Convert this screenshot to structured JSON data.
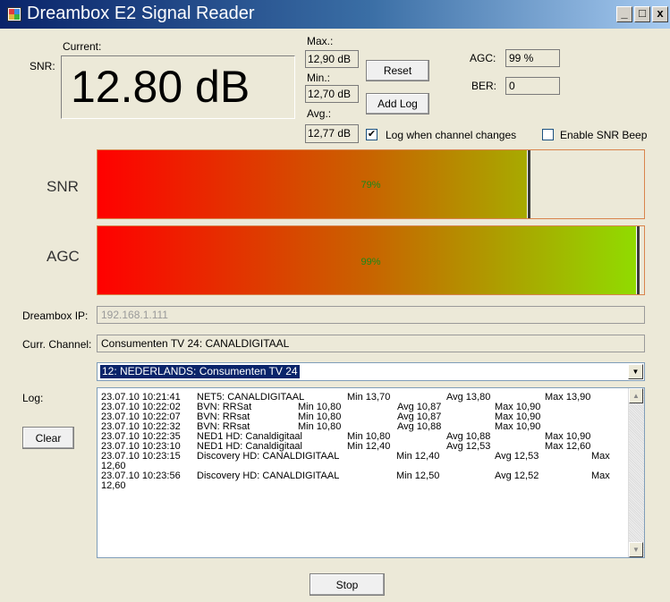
{
  "window": {
    "title": "Dreambox E2 Signal Reader",
    "minimize": "_",
    "maximize": "□",
    "close": "x"
  },
  "snr_panel": {
    "snr_label": "SNR:",
    "current_label": "Current:",
    "current_value": "12.80 dB"
  },
  "stats": {
    "max_label": "Max.:",
    "max_value": "12,90 dB",
    "min_label": "Min.:",
    "min_value": "12,70 dB",
    "avg_label": "Avg.:",
    "avg_value": "12,77 dB"
  },
  "buttons": {
    "reset": "Reset",
    "add_log": "Add Log",
    "clear": "Clear",
    "stop": "Stop"
  },
  "agc": {
    "label": "AGC:",
    "value": "99 %"
  },
  "ber": {
    "label": "BER:",
    "value": "0"
  },
  "options": {
    "log_channel_change": {
      "label": "Log when channel changes",
      "checked": true
    },
    "enable_snr_beep": {
      "label": "Enable SNR Beep",
      "checked": false
    }
  },
  "bars": {
    "snr": {
      "label": "SNR",
      "percent_text": "79%",
      "level": 0.79
    },
    "agc": {
      "label": "AGC",
      "percent_text": "99%",
      "level": 0.99
    }
  },
  "dreambox_ip": {
    "label": "Dreambox IP:",
    "value": "192.168.1.111"
  },
  "current_channel": {
    "label": "Curr. Channel:",
    "value": "Consumenten TV 24: CANALDIGITAAL"
  },
  "channel_select": {
    "selected": "12: NEDERLANDS: Consumenten TV 24"
  },
  "log": {
    "label": "Log:",
    "entries": [
      {
        "time": "23.07.10 10:21:41",
        "channel": "NET5: CANALDIGITAAL",
        "min": "Min 13,70",
        "avg": "Avg 13,80",
        "max": "Max 13,90"
      },
      {
        "time": "23.07.10 10:22:02",
        "channel": "BVN: RRSat",
        "min": "Min 10,80",
        "avg": "Avg 10,87",
        "max": "Max 10,90"
      },
      {
        "time": "23.07.10 10:22:07",
        "channel": "BVN: RRsat",
        "min": "Min 10,80",
        "avg": "Avg 10,87",
        "max": "Max 10,90"
      },
      {
        "time": "23.07.10 10:22:32",
        "channel": "BVN: RRsat",
        "min": "Min 10,80",
        "avg": "Avg 10,88",
        "max": "Max 10,90"
      },
      {
        "time": "23.07.10 10:22:35",
        "channel": "NED1 HD: Canaldigitaal",
        "min": "Min 10,80",
        "avg": "Avg 10,88",
        "max": "Max 10,90"
      },
      {
        "time": "23.07.10 10:23:10",
        "channel": "NED1 HD: Canaldigitaal",
        "min": "Min 12,40",
        "avg": "Avg 12,53",
        "max": "Max 12,60"
      },
      {
        "time": "23.07.10 10:23:15",
        "channel": "Discovery HD: CANALDIGITAAL",
        "min": "Min 12,40",
        "avg": "Avg 12,53",
        "max": "Max",
        "wrap": "12,60"
      },
      {
        "time": "23.07.10 10:23:56",
        "channel": "Discovery HD: CANALDIGITAAL",
        "min": "Min 12,50",
        "avg": "Avg 12,52",
        "max": "Max",
        "wrap": "12,60"
      }
    ]
  }
}
